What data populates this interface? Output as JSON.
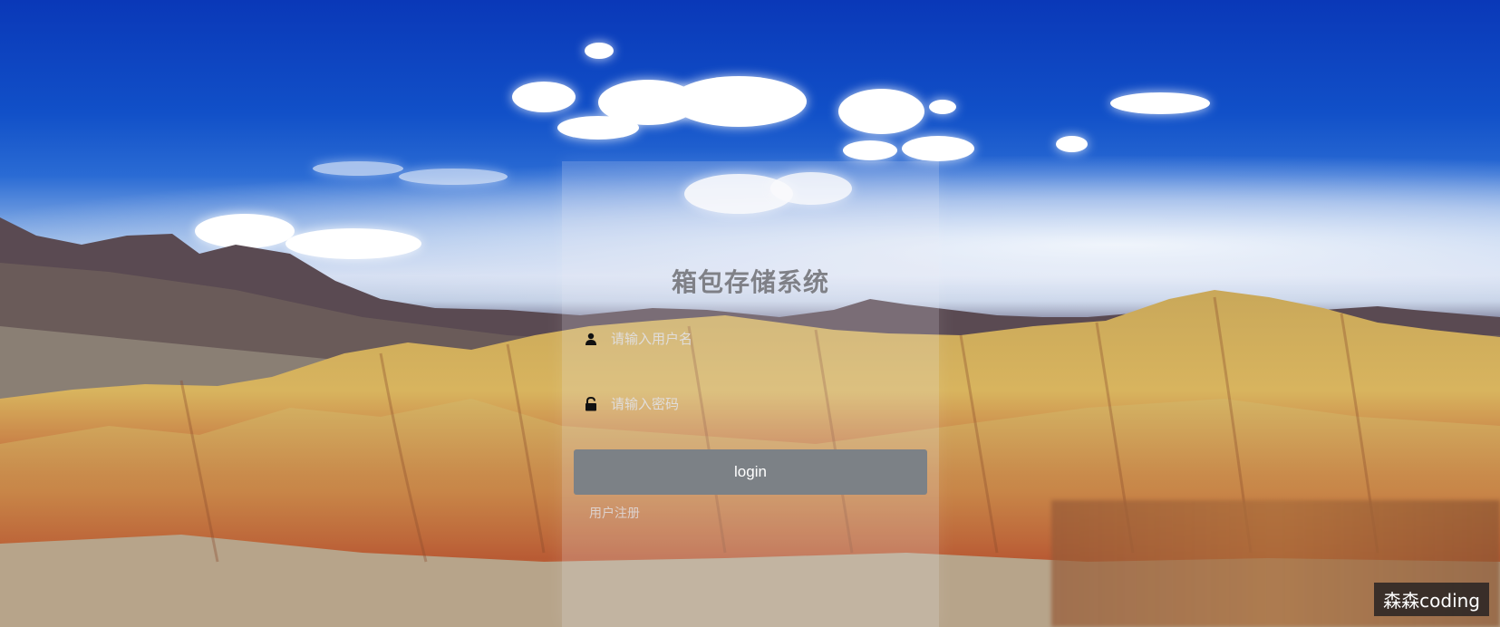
{
  "app": {
    "title": "箱包存储系统"
  },
  "login": {
    "username_placeholder": "请输入用户名",
    "password_placeholder": "请输入密码",
    "button_label": "login",
    "register_label": "用户注册"
  },
  "icons": {
    "username": "user-icon",
    "password": "lock-icon"
  },
  "watermark": {
    "text": "森森coding"
  },
  "colors": {
    "button_bg": "#7c8186",
    "sky": "#0a38b8"
  }
}
